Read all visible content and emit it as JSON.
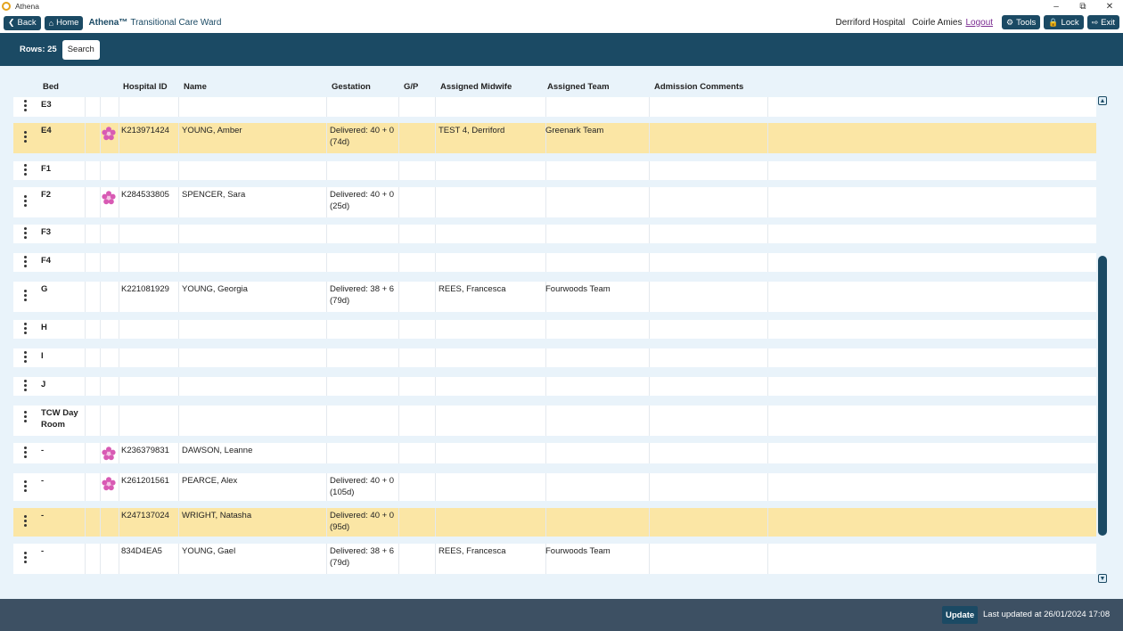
{
  "window": {
    "title": "Athena"
  },
  "nav": {
    "back": "Back",
    "home": "Home",
    "brand": "Athena™",
    "ward": "Transitional Care Ward",
    "hospital": "Derriford Hospital",
    "user": "Coirle Amies",
    "logout": "Logout",
    "tools": "Tools",
    "lock": "Lock",
    "exit": "Exit"
  },
  "toolbar": {
    "rows_label": "Rows: 25",
    "search": "Search"
  },
  "columns": {
    "bed": "Bed",
    "hospital_id": "Hospital ID",
    "name": "Name",
    "gestation": "Gestation",
    "gp": "G/P",
    "midwife": "Assigned Midwife",
    "team": "Assigned Team",
    "comments": "Admission Comments"
  },
  "rows": [
    {
      "bed": "E3",
      "id": "",
      "name": "",
      "gest1": "",
      "gest2": "",
      "midwife": "",
      "team": "",
      "icon": false,
      "highlight": false
    },
    {
      "bed": "E4",
      "id": "K213971424",
      "name": "YOUNG, Amber",
      "gest1": "Delivered: 40 + 0",
      "gest2": "(74d)",
      "midwife": "TEST 4, Derriford",
      "team": "Greenark Team",
      "icon": true,
      "highlight": true
    },
    {
      "bed": "F1",
      "id": "",
      "name": "",
      "gest1": "",
      "gest2": "",
      "midwife": "",
      "team": "",
      "icon": false,
      "highlight": false
    },
    {
      "bed": "F2",
      "id": "K284533805",
      "name": "SPENCER, Sara",
      "gest1": "Delivered: 40 + 0",
      "gest2": "(25d)",
      "midwife": "",
      "team": "",
      "icon": true,
      "highlight": false
    },
    {
      "bed": "F3",
      "id": "",
      "name": "",
      "gest1": "",
      "gest2": "",
      "midwife": "",
      "team": "",
      "icon": false,
      "highlight": false
    },
    {
      "bed": "F4",
      "id": "",
      "name": "",
      "gest1": "",
      "gest2": "",
      "midwife": "",
      "team": "",
      "icon": false,
      "highlight": false
    },
    {
      "bed": "G",
      "id": "K221081929",
      "name": "YOUNG, Georgia",
      "gest1": "Delivered: 38 + 6",
      "gest2": "(79d)",
      "midwife": "REES, Francesca",
      "team": "Fourwoods Team",
      "icon": false,
      "highlight": false
    },
    {
      "bed": "H",
      "id": "",
      "name": "",
      "gest1": "",
      "gest2": "",
      "midwife": "",
      "team": "",
      "icon": false,
      "highlight": false
    },
    {
      "bed": "I",
      "id": "",
      "name": "",
      "gest1": "",
      "gest2": "",
      "midwife": "",
      "team": "",
      "icon": false,
      "highlight": false
    },
    {
      "bed": "J",
      "id": "",
      "name": "",
      "gest1": "",
      "gest2": "",
      "midwife": "",
      "team": "",
      "icon": false,
      "highlight": false
    },
    {
      "bed": "TCW Day",
      "bed2": "Room",
      "id": "",
      "name": "",
      "gest1": "",
      "gest2": "",
      "midwife": "",
      "team": "",
      "icon": false,
      "highlight": false
    },
    {
      "bed": "-",
      "id": "K236379831",
      "name": "DAWSON, Leanne",
      "gest1": "",
      "gest2": "",
      "midwife": "",
      "team": "",
      "icon": true,
      "highlight": false
    },
    {
      "bed": "-",
      "id": "K261201561",
      "name": "PEARCE, Alex",
      "gest1": "Delivered: 40 + 0",
      "gest2": "(105d)",
      "midwife": "",
      "team": "",
      "icon": true,
      "highlight": false
    },
    {
      "bed": "-",
      "id": "K247137024",
      "name": "WRIGHT, Natasha",
      "gest1": "Delivered: 40 + 0",
      "gest2": "(95d)",
      "midwife": "",
      "team": "",
      "icon": false,
      "highlight": true
    },
    {
      "bed": "-",
      "id": "834D4EA5",
      "name": "YOUNG, Gael",
      "gest1": "Delivered: 38 + 6",
      "gest2": "(79d)",
      "midwife": "REES, Francesca",
      "team": "Fourwoods Team",
      "icon": false,
      "highlight": false
    }
  ],
  "footer": {
    "update": "Update",
    "last_updated": "Last updated at 26/01/2024 17:08"
  },
  "colors": {
    "primary": "#1b4a64",
    "highlight": "#fbe6a5",
    "background": "#e9f3fa",
    "footer": "#3d5063",
    "logout": "#7a2b91"
  }
}
